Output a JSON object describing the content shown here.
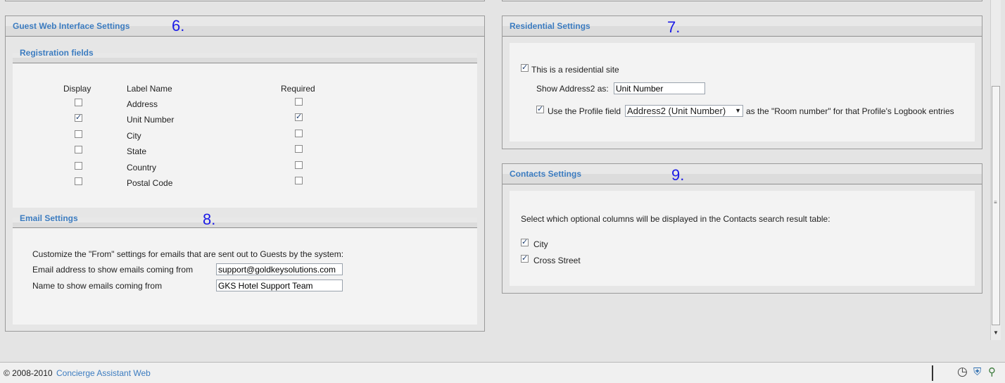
{
  "guest_panel": {
    "title": "Guest Web Interface Settings",
    "annotation": "6.",
    "registration": {
      "title": "Registration fields",
      "col_display": "Display",
      "col_label": "Label Name",
      "col_required": "Required",
      "rows": [
        {
          "label": "Address",
          "display": false,
          "required": false
        },
        {
          "label": "Unit Number",
          "display": true,
          "required": true
        },
        {
          "label": "City",
          "display": false,
          "required": false
        },
        {
          "label": "State",
          "display": false,
          "required": false
        },
        {
          "label": "Country",
          "display": false,
          "required": false
        },
        {
          "label": "Postal Code",
          "display": false,
          "required": false
        }
      ]
    },
    "email": {
      "title": "Email Settings",
      "annotation": "8.",
      "intro": "Customize the \"From\" settings for emails that are sent out to Guests by the system:",
      "address_label": "Email address to show emails coming from",
      "address_value": "support@goldkeysolutions.com",
      "name_label": "Name to show emails coming from",
      "name_value": "GKS Hotel Support Team"
    }
  },
  "residential_panel": {
    "title": "Residential Settings",
    "annotation": "7.",
    "is_residential_label": "This is a residential site",
    "is_residential": true,
    "address2_label": "Show Address2 as:",
    "address2_value": "Unit Number",
    "use_profile_label": "Use the Profile field",
    "use_profile": true,
    "profile_field_selected": "Address2 (Unit Number)",
    "room_number_suffix": "as the \"Room number\" for that Profile's Logbook entries"
  },
  "contacts_panel": {
    "title": "Contacts Settings",
    "annotation": "9.",
    "description": "Select which optional columns will be displayed in the Contacts search result table:",
    "options": [
      {
        "label": "City",
        "checked": true
      },
      {
        "label": "Cross Street",
        "checked": true
      }
    ]
  },
  "footer": {
    "copyright": "© 2008-2010",
    "link": "Concierge Assistant Web"
  },
  "colors": {
    "title_blue": "#3c7cc0",
    "annotation_blue": "#1a1ae6"
  }
}
